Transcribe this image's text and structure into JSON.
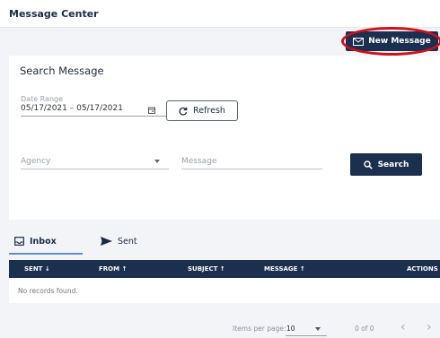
{
  "header": {
    "title": "Message Center"
  },
  "toolbar": {
    "new_message_label": "New Message"
  },
  "search": {
    "title": "Search Message",
    "date_range_label": "Date Range",
    "date_range_value": "05/17/2021 – 05/17/2021",
    "refresh_label": "Refresh",
    "agency_placeholder": "Agency",
    "message_placeholder": "Message",
    "search_label": "Search"
  },
  "tabs": [
    {
      "label": "Inbox",
      "icon": "inbox-icon",
      "active": true
    },
    {
      "label": "Sent",
      "icon": "send-icon",
      "active": false
    }
  ],
  "table": {
    "columns": [
      "SENT ↓",
      "FROM ↑",
      "SUBJECT ↑",
      "MESSAGE ↑",
      "ACTIONS"
    ],
    "empty_text": "No records found."
  },
  "paginator": {
    "items_per_page_label": "Items per page:",
    "items_per_page_value": "10",
    "range_label": "0 of 0"
  },
  "colors": {
    "primary": "#1b2f4f",
    "highlight_ring": "#d0101d",
    "tab_accent": "#5a8fd8"
  }
}
